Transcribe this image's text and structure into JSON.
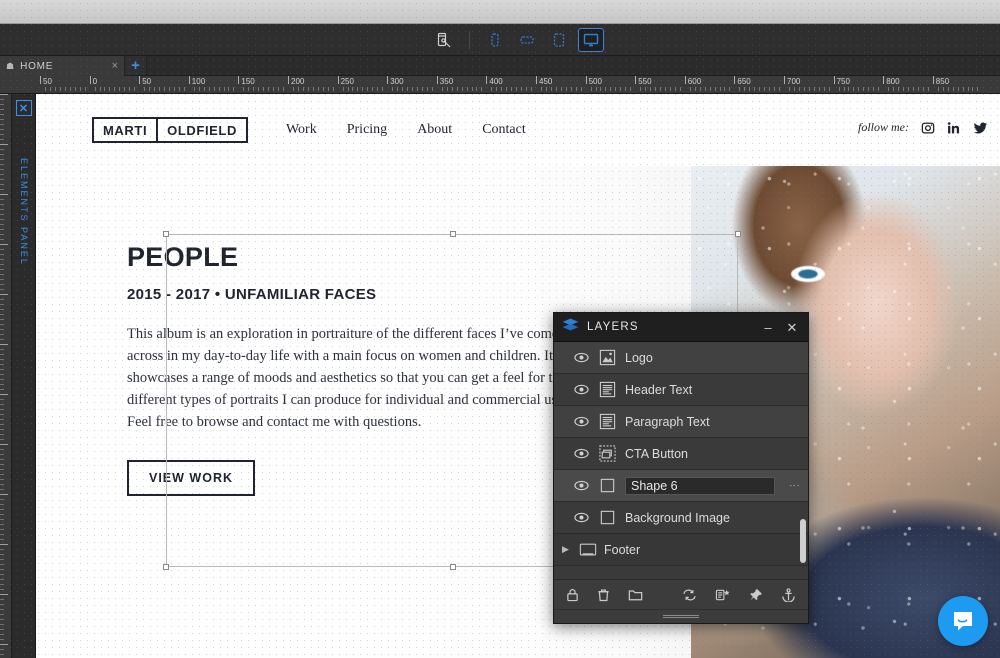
{
  "toolbar": {
    "inspect_label": "inspect-device",
    "devices": [
      {
        "name": "phone-portrait",
        "label": "Phone",
        "active": false
      },
      {
        "name": "phone-landscape",
        "label": "Phone Landscape",
        "active": false
      },
      {
        "name": "tablet",
        "label": "Tablet",
        "active": false
      },
      {
        "name": "desktop",
        "label": "Desktop",
        "active": true
      }
    ]
  },
  "tabs": {
    "items": [
      {
        "label": "HOME",
        "icon": "home-icon",
        "close": "×"
      }
    ],
    "add_label": "+"
  },
  "elements_panel": {
    "title": "ELEMENTS PANEL",
    "close_label": "✕"
  },
  "ruler": {
    "labels": [
      "50",
      "0",
      "50",
      "100",
      "150",
      "200",
      "250",
      "300",
      "350",
      "400",
      "450",
      "500",
      "550",
      "600",
      "650",
      "700",
      "750",
      "800",
      "850"
    ],
    "unit": "px"
  },
  "site": {
    "logo": {
      "first": "MARTI",
      "second": "OLDFIELD"
    },
    "nav": [
      "Work",
      "Pricing",
      "About",
      "Contact"
    ],
    "follow": {
      "label": "follow me:",
      "socials": [
        "instagram-icon",
        "linkedin-icon",
        "twitter-icon"
      ]
    },
    "hero": {
      "title": "PEOPLE",
      "subtitle": "2015 - 2017  •  UNFAMILIAR FACES",
      "paragraph": "This album is an exploration in portraiture of the different faces I’ve come across in my day-to-day life with a main focus on women and children. It showcases a range of moods and aesthetics so that you can get a feel for the different types of portraits I can produce for individual and commercial use. Feel free to browse and contact me with questions.",
      "cta": "VIEW WORK"
    }
  },
  "layers_panel": {
    "title": "LAYERS",
    "icon": "layers-stack-icon",
    "minimize_label": "–",
    "close_label": "✕",
    "rows": [
      {
        "name": "Logo",
        "icon": "image-layer-icon",
        "visible": true,
        "selected": false,
        "editing": false,
        "group": false
      },
      {
        "name": "Header Text",
        "icon": "text-layer-icon",
        "visible": true,
        "selected": false,
        "editing": false,
        "group": false
      },
      {
        "name": "Paragraph Text",
        "icon": "text-layer-icon",
        "visible": true,
        "selected": false,
        "editing": false,
        "group": false
      },
      {
        "name": "CTA Button",
        "icon": "button-layer-icon",
        "visible": true,
        "selected": false,
        "editing": false,
        "group": false
      },
      {
        "name": "Shape 6",
        "icon": "shape-layer-icon",
        "visible": true,
        "selected": true,
        "editing": true,
        "group": false
      },
      {
        "name": "Background Image",
        "icon": "shape-layer-icon",
        "visible": true,
        "selected": false,
        "editing": false,
        "group": false
      },
      {
        "name": "Footer",
        "icon": "group-layer-icon",
        "visible": false,
        "selected": false,
        "editing": false,
        "group": true
      }
    ],
    "footer_tools_left": [
      "lock-icon",
      "trash-icon",
      "folder-icon"
    ],
    "footer_tools_right": [
      "sync-icon",
      "add-to-list-icon",
      "pin-icon",
      "anchor-icon"
    ]
  },
  "chat": {
    "icon": "chat-bubble-icon",
    "color": "#1d9bf0"
  },
  "colors": {
    "accent": "#3d8fe8",
    "panel_bg": "#3c3c3c",
    "panel_header": "#1f1f1f",
    "site_ink": "#20242e"
  }
}
